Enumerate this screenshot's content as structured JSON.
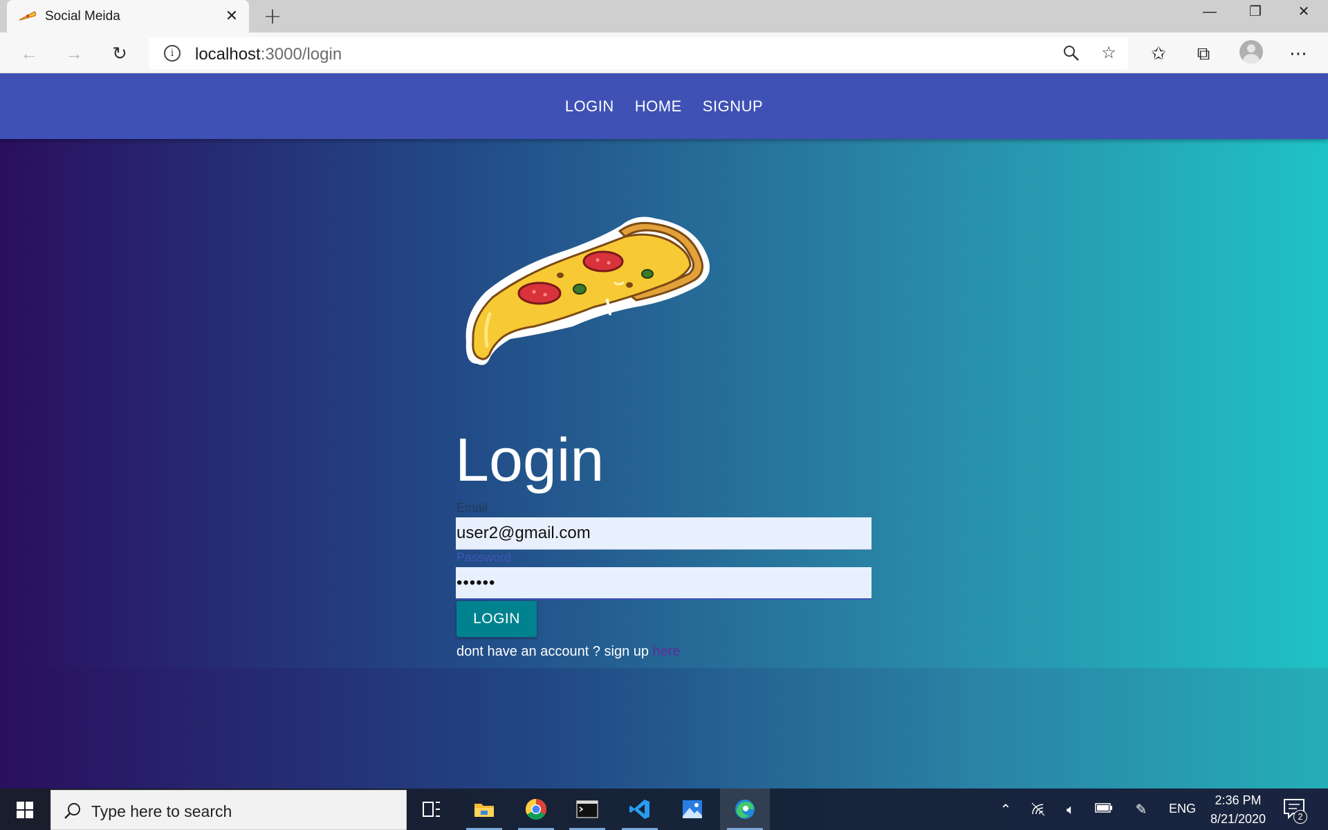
{
  "browser": {
    "tab_title": "Social Meida",
    "url_host": "localhost",
    "url_path": ":3000/login",
    "icons": [
      "back-icon",
      "forward-icon",
      "refresh-icon",
      "info-icon",
      "zoom-icon",
      "star-icon",
      "favorites-icon",
      "collections-icon",
      "profile-icon",
      "more-icon"
    ]
  },
  "navbar": {
    "links": [
      "LOGIN",
      "HOME",
      "SIGNUP"
    ],
    "color": "#3f51b5"
  },
  "login": {
    "title": "Login",
    "email_label": "Email",
    "email_value": "user2@gmail.com",
    "password_label": "Password",
    "password_value": "••••••",
    "button_label": "LOGIN",
    "signup_text": "dont have an account ? sign up ",
    "signup_link": "here",
    "button_color": "#00838f"
  },
  "taskbar": {
    "search_placeholder": "Type here to search",
    "language": "ENG",
    "time": "2:36 PM",
    "date": "8/21/2020",
    "notification_count": "2"
  }
}
